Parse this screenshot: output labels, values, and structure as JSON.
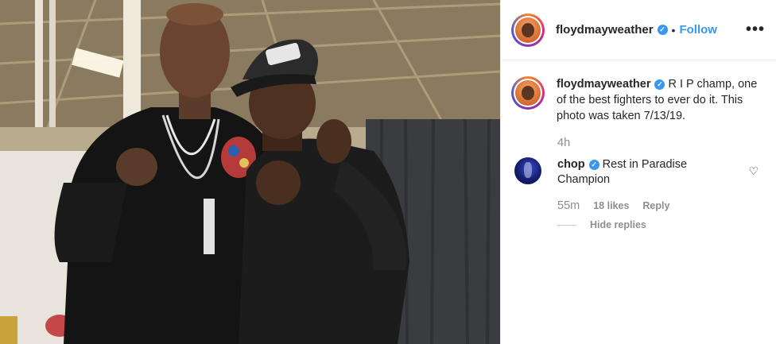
{
  "post": {
    "photo_alt": "",
    "header": {
      "username": "floydmayweather",
      "separator": "•",
      "follow_label": "Follow",
      "more_label": "•••"
    },
    "caption": {
      "username": "floydmayweather",
      "text": "R I P champ, one of the best fighters to ever do it. This photo was taken 7/13/19.",
      "time": "4h"
    },
    "comments": [
      {
        "username": "chop",
        "text": "Rest in Paradise Champion",
        "time": "55m",
        "likes": "18 likes",
        "reply_label": "Reply",
        "hide_replies_label": "Hide replies"
      }
    ],
    "icons": {
      "verified": "verified-badge-icon",
      "heart": "heart-outline-icon",
      "more": "more-options-icon"
    },
    "colors": {
      "link_blue": "#3897f0",
      "muted_gray": "#8e8e8e",
      "text": "#262626"
    }
  }
}
